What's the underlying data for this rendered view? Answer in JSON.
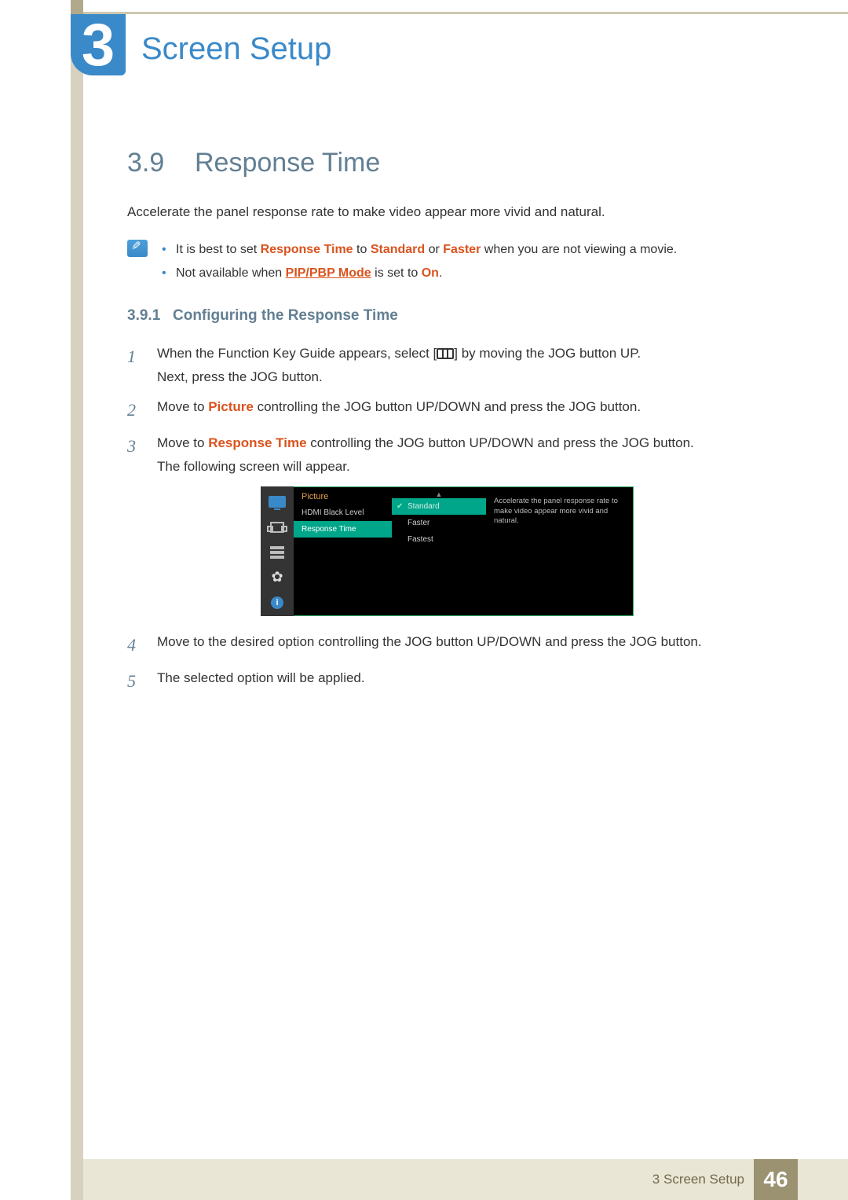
{
  "chapter": {
    "number": "3",
    "title": "Screen Setup"
  },
  "section": {
    "number": "3.9",
    "title": "Response Time"
  },
  "intro": "Accelerate the panel response rate to make video appear more vivid and natural.",
  "notes": {
    "n1_a": "It is best to set ",
    "n1_b": "Response Time",
    "n1_c": " to ",
    "n1_d": "Standard",
    "n1_e": " or ",
    "n1_f": "Faster",
    "n1_g": " when you are not viewing a movie.",
    "n2_a": "Not available when ",
    "n2_b": "PIP/PBP Mode",
    "n2_c": " is set to ",
    "n2_d": "On",
    "n2_e": "."
  },
  "subsection": {
    "number": "3.9.1",
    "title": "Configuring the Response Time"
  },
  "steps": {
    "s1": {
      "num": "1",
      "a": "When the Function Key Guide appears, select [",
      "b": "] by moving the JOG button UP.",
      "c": "Next, press the JOG button."
    },
    "s2": {
      "num": "2",
      "a": "Move to ",
      "hl": "Picture",
      "b": " controlling the JOG button UP/DOWN and press the JOG button."
    },
    "s3": {
      "num": "3",
      "a": "Move to ",
      "hl": "Response Time",
      "b": " controlling the JOG button UP/DOWN and press the JOG button.",
      "c": "The following screen will appear."
    },
    "s4": {
      "num": "4",
      "a": "Move to the desired option controlling the JOG button UP/DOWN and press the JOG button."
    },
    "s5": {
      "num": "5",
      "a": "The selected option will be applied."
    }
  },
  "osd": {
    "menu_header": "Picture",
    "item1": "HDMI Black Level",
    "item2": "Response Time",
    "opt1": "Standard",
    "opt2": "Faster",
    "opt3": "Fastest",
    "desc": "Accelerate the panel response rate to make video appear more vivid and natural.",
    "info_glyph": "i"
  },
  "footer": {
    "label": "3 Screen Setup",
    "page": "46"
  }
}
